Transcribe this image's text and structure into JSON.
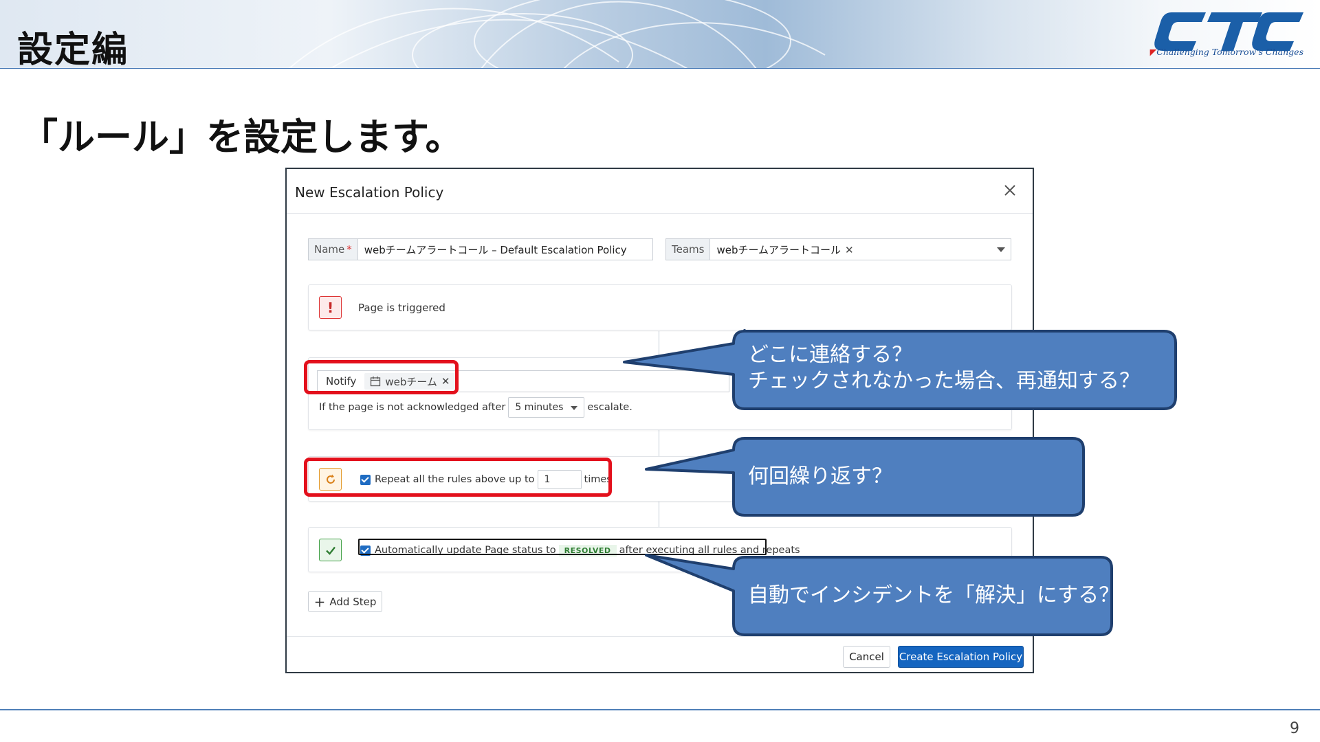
{
  "header": {
    "section_title": "設定編",
    "logo_text": "CTC",
    "logo_tagline": "Challenging Tomorrow's Changes"
  },
  "slide": {
    "heading": "「ルール」を設定します。",
    "page_number": "9"
  },
  "dialog": {
    "title": "New Escalation Policy",
    "name_label": "Name",
    "required_mark": "*",
    "name_value": "webチームアラートコール – Default Escalation Policy",
    "teams_label": "Teams",
    "teams_chip": "webチームアラートコール",
    "trigger_text": "Page is triggered",
    "notify_label": "Notify",
    "notify_chip": "webチーム",
    "escalate_prefix": "If the page is not acknowledged after",
    "escalate_select": "5 minutes",
    "escalate_suffix": "escalate.",
    "repeat_prefix": "Repeat all the rules above up to",
    "repeat_value": "1",
    "repeat_suffix": "times",
    "auto_prefix": "Automatically update Page status to",
    "auto_badge": "RESOLVED",
    "auto_suffix": "after executing all rules and repeats",
    "add_step": "Add Step",
    "cancel": "Cancel",
    "create": "Create Escalation Policy"
  },
  "callouts": {
    "notify_line1": "どこに連絡する？",
    "notify_line2": "チェックされなかった場合、再通知する？",
    "repeat": "何回繰り返す？",
    "resolve": "自動でインシデントを「解決」にする？"
  },
  "colors": {
    "callout_fill": "#4f7fbf",
    "callout_border": "#1f3f6e",
    "highlight_red": "#e3101c",
    "primary_button": "#1565c0",
    "brand_blue": "#1b5fa8"
  }
}
